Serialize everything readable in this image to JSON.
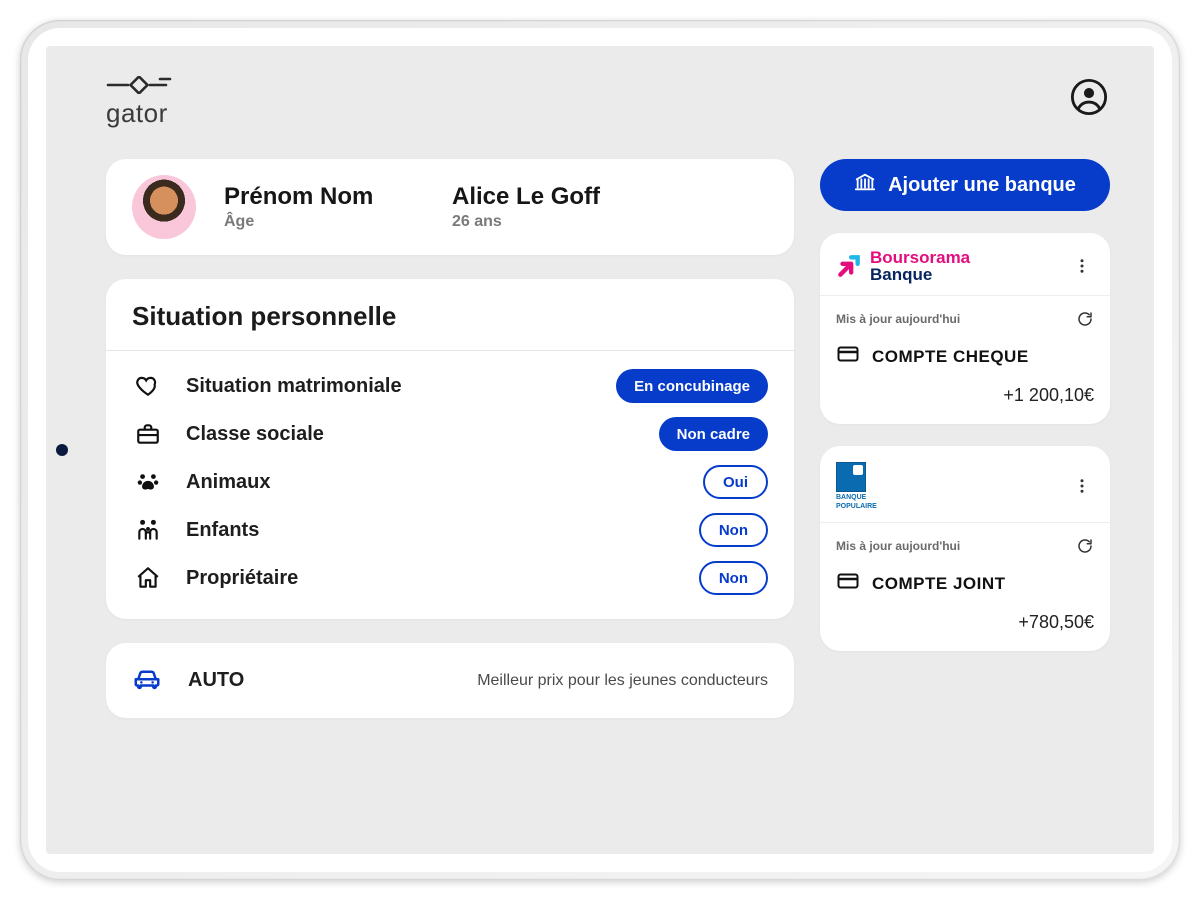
{
  "brand": {
    "name": "gator"
  },
  "header": {
    "account_icon": "account-circle"
  },
  "profile": {
    "name_label": "Prénom Nom",
    "age_label": "Âge",
    "name_value": "Alice Le Goff",
    "age_value": "26 ans"
  },
  "situation": {
    "title": "Situation personnelle",
    "rows": [
      {
        "icon": "heart",
        "label": "Situation matrimoniale",
        "value": "En concubinage",
        "style": "filled"
      },
      {
        "icon": "briefcase",
        "label": "Classe sociale",
        "value": "Non cadre",
        "style": "filled"
      },
      {
        "icon": "paw",
        "label": "Animaux",
        "value": "Oui",
        "style": "outline"
      },
      {
        "icon": "family",
        "label": "Enfants",
        "value": "Non",
        "style": "outline"
      },
      {
        "icon": "home",
        "label": "Propriétaire",
        "value": "Non",
        "style": "outline"
      }
    ]
  },
  "auto": {
    "title": "AUTO",
    "subtitle": "Meilleur prix pour les jeunes conducteurs"
  },
  "sidebar": {
    "add_bank_label": "Ajouter une banque",
    "banks": [
      {
        "name_line1": "Boursorama",
        "name_line2": "Banque",
        "updated": "Mis à jour aujourd'hui",
        "account_label": "COMPTE CHEQUE",
        "balance": "+1 200,10€"
      },
      {
        "name_line1": "BANQUE",
        "name_line2": "POPULAIRE",
        "updated": "Mis à jour aujourd'hui",
        "account_label": "COMPTE JOINT",
        "balance": "+780,50€"
      }
    ]
  },
  "colors": {
    "primary": "#073ccb",
    "magenta": "#e40d7e",
    "navy": "#06245f"
  }
}
